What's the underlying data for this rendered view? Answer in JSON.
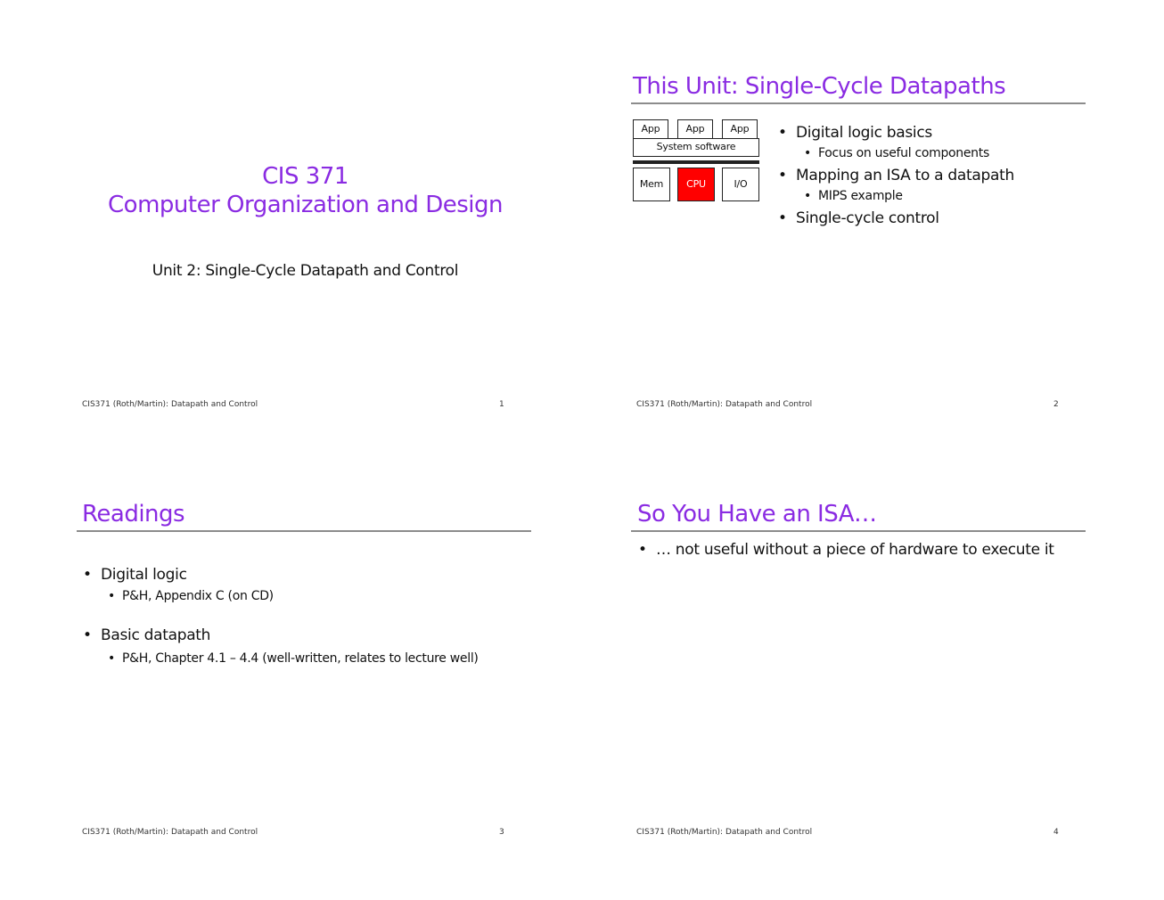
{
  "footer_text": "CIS371 (Roth/Martin): Datapath and Control",
  "slides": [
    {
      "course_number": "CIS 371",
      "course_title": "Computer Organization and Design",
      "subtitle": "Unit 2: Single-Cycle Datapath and Control",
      "page": "1"
    },
    {
      "title": "This Unit: Single-Cycle Datapaths",
      "diagram": {
        "app1": "App",
        "app2": "App",
        "app3": "App",
        "system_software": "System software",
        "mem": "Mem",
        "cpu": "CPU",
        "io": "I/O"
      },
      "bullets": [
        {
          "text": "Digital logic basics",
          "sub": [
            "Focus on useful components"
          ]
        },
        {
          "text": "Mapping an ISA to a datapath",
          "sub": [
            "MIPS example"
          ]
        },
        {
          "text": "Single-cycle control",
          "sub": []
        }
      ],
      "page": "2"
    },
    {
      "title": "Readings",
      "bullets": [
        {
          "text": "Digital logic",
          "sub": [
            "P&H, Appendix C (on CD)"
          ]
        },
        {
          "text": "Basic datapath",
          "sub": [
            "P&H, Chapter 4.1 – 4.4   (well-written, relates to lecture well)"
          ]
        }
      ],
      "page": "3"
    },
    {
      "title": "So You Have an ISA…",
      "bullets": [
        {
          "text": "… not useful without a piece of hardware to execute it",
          "sub": []
        }
      ],
      "page": "4"
    }
  ]
}
